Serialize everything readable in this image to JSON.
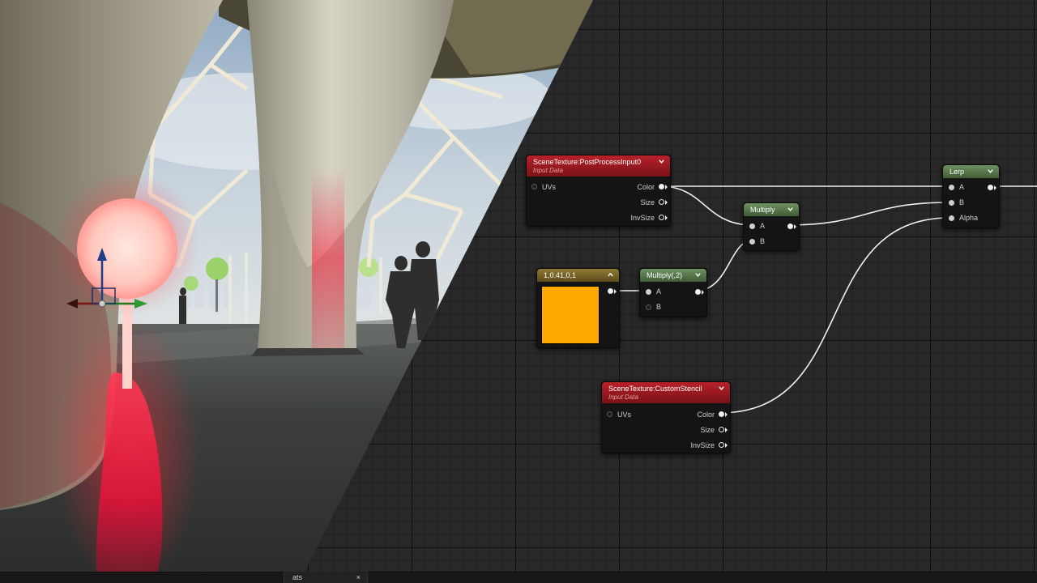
{
  "nodes": {
    "postprocess": {
      "title": "SceneTexture:PostProcessInput0",
      "subtitle": "Input Data",
      "inputs": [
        "UVs"
      ],
      "outputs": [
        "Color",
        "Size",
        "InvSize"
      ]
    },
    "constant": {
      "title": "1,0.41,0,1",
      "swatch_color": "#FFA800"
    },
    "multiply2": {
      "title": "Multiply(,2)",
      "inputs": [
        "A",
        "B"
      ]
    },
    "multiply": {
      "title": "Multiply",
      "inputs": [
        "A",
        "B"
      ]
    },
    "lerp": {
      "title": "Lerp",
      "inputs": [
        "A",
        "B",
        "Alpha"
      ]
    },
    "stencil": {
      "title": "SceneTexture:CustomStencil",
      "subtitle": "Input Data",
      "inputs": [
        "UVs"
      ],
      "outputs": [
        "Color",
        "Size",
        "InvSize"
      ]
    }
  },
  "bottom_tab": {
    "label": "ats",
    "close": "×"
  },
  "icons": {
    "node_collapse": "chevron-down-icon",
    "gizmo": "transform-gizmo-icon"
  },
  "colors": {
    "scene_texture_header": "#B0202A",
    "math_header": "#5F7F52",
    "constant_header": "#7F6A2A",
    "wire": "#FFFFFF",
    "glow": "#FF1A3A"
  }
}
